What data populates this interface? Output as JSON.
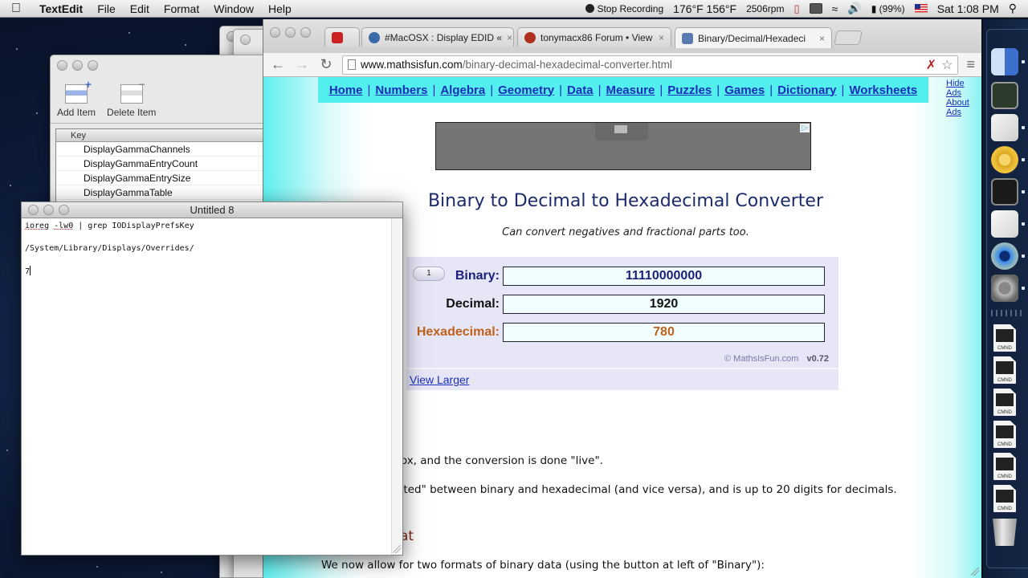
{
  "menubar": {
    "apple": "",
    "app_name": "TextEdit",
    "menus": [
      "File",
      "Edit",
      "Format",
      "Window",
      "Help"
    ],
    "status": {
      "recording": "Stop Recording",
      "temps": "176°F 156°F",
      "fan": "2506rpm",
      "battery": "(99%)",
      "clock": "Sat 1:08 PM"
    }
  },
  "plist_editor": {
    "toolbar": {
      "add_item": "Add Item",
      "delete_item": "Delete Item"
    },
    "column_header": "Key",
    "rows": [
      "DisplayGammaChannels",
      "DisplayGammaEntryCount",
      "DisplayGammaEntrySize",
      "DisplayGammaTable"
    ]
  },
  "textedit": {
    "title": "Untitled 8",
    "lines": {
      "cmd_word1": "ioreg",
      "cmd_word2": "-lw0",
      "cmd_rest": " | grep IODisplayPrefsKey",
      "path": "/System/Library/Displays/Overrides/",
      "last": "7"
    }
  },
  "browser": {
    "tabs": [
      {
        "label": "",
        "icon": "youtube-icon",
        "color": "#cc2222"
      },
      {
        "label": "#MacOSX : Display EDID «",
        "icon": "wordpress-icon",
        "color": "#3a6aa8"
      },
      {
        "label": "tonymacx86 Forum • View",
        "icon": "tonymacx86-icon",
        "color": "#b03020"
      },
      {
        "label": "Binary/Decimal/Hexadeci",
        "icon": "mathsisfun-icon",
        "color": "#5a7ab0",
        "active": true
      }
    ],
    "tab_close": "×",
    "url_host": "www.mathsisfun.com",
    "url_path": "/binary-decimal-hexadecimal-converter.html"
  },
  "page": {
    "nav": [
      "Home",
      "Numbers",
      "Algebra",
      "Geometry",
      "Data",
      "Measure",
      "Puzzles",
      "Games",
      "Dictionary",
      "Worksheets"
    ],
    "hide_ads": "Hide Ads",
    "about_ads": "About Ads",
    "title": "Binary to Decimal to Hexadecimal Converter",
    "subtitle": "Can convert negatives and fractional parts too.",
    "converter": {
      "format_button": "1",
      "binary_label": "Binary:",
      "binary_value": "11110000000",
      "decimal_label": "Decimal:",
      "decimal_value": "1920",
      "hex_label": "Hexadecimal:",
      "hex_value": "780",
      "credit": "© MathsIsFun.com",
      "version": "v0.72",
      "view_larger": "View Larger"
    },
    "para1_fragment": "y box, and the conversion is done \"live\".",
    "para2_fragment": "limited\" between binary and hexadecimal (and vice versa), and is up to 20 digits for decimals.",
    "heading_fragment": "at",
    "para3": "We now allow for two formats of binary data (using the button at left of \"Binary\"):",
    "colors": {
      "binary": "#1a1f7a",
      "decimal": "#111111",
      "hex": "#c0601a",
      "nav_bg": "#53efef",
      "link": "#1a2fb8"
    }
  },
  "dock": {
    "apps": [
      "finder-icon",
      "activity-monitor-icon",
      "plist-editor-icon",
      "chrome-icon",
      "terminal-icon",
      "textedit-icon",
      "quicktime-icon",
      "system-preferences-icon"
    ],
    "files": [
      "CMND",
      "CMND",
      "CMND",
      "CMND",
      "CMND",
      "CMND"
    ],
    "trash": "trash-icon"
  }
}
